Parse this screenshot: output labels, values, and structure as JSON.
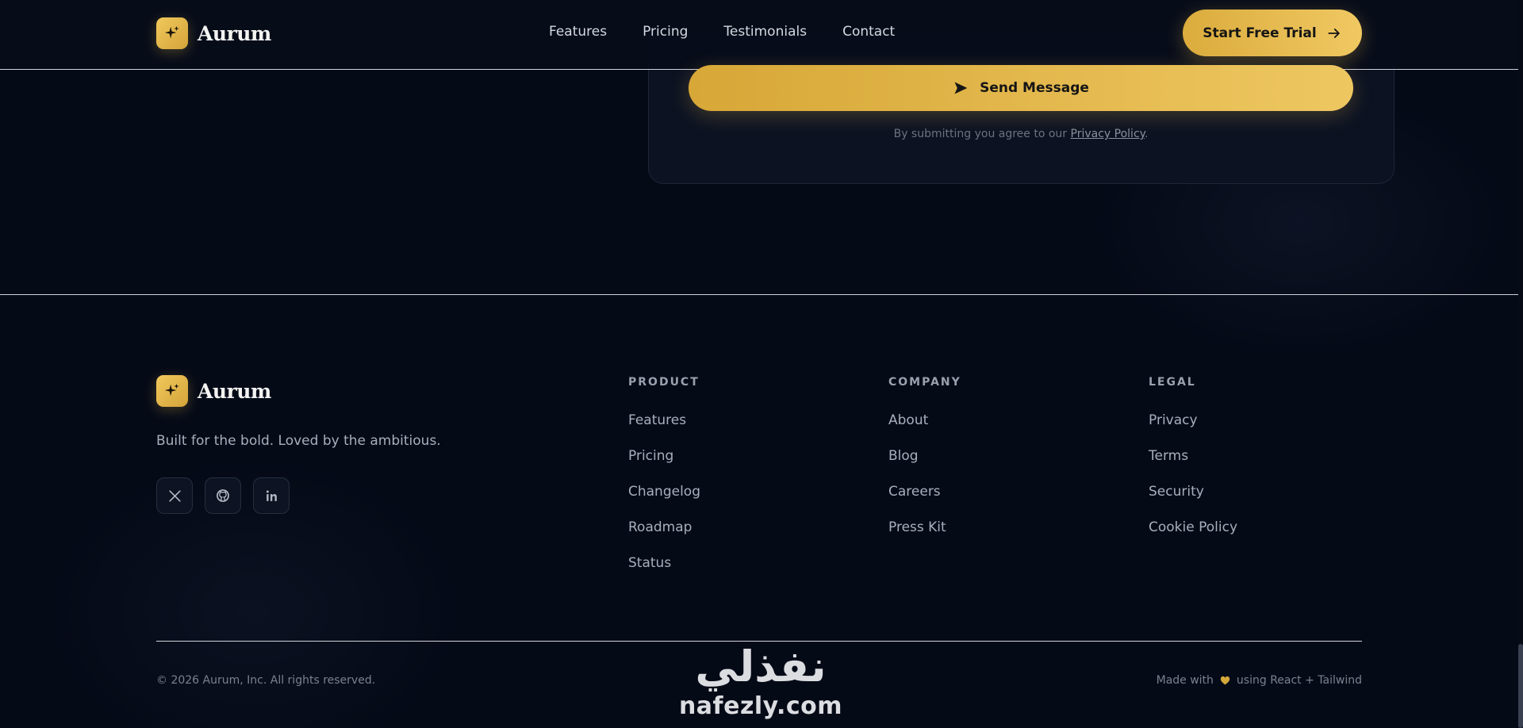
{
  "header": {
    "brand": "Aurum",
    "nav": [
      "Features",
      "Pricing",
      "Testimonials",
      "Contact"
    ],
    "cta_label": "Start Free Trial"
  },
  "contact_form": {
    "send_label": "Send Message",
    "terms_prefix": "By submitting you agree to our ",
    "privacy_link": "Privacy Policy",
    "terms_suffix": "."
  },
  "footer": {
    "brand": "Aurum",
    "tagline": "Built for the bold. Loved by the ambitious.",
    "socials": [
      "x-icon",
      "github-icon",
      "linkedin-icon"
    ],
    "columns": [
      {
        "title": "PRODUCT",
        "links": [
          "Features",
          "Pricing",
          "Changelog",
          "Roadmap",
          "Status"
        ]
      },
      {
        "title": "COMPANY",
        "links": [
          "About",
          "Blog",
          "Careers",
          "Press Kit"
        ]
      },
      {
        "title": "LEGAL",
        "links": [
          "Privacy",
          "Terms",
          "Security",
          "Cookie Policy"
        ]
      }
    ],
    "copyright": "© 2026 Aurum, Inc. All rights reserved.",
    "made_with_prefix": "Made with",
    "made_with_suffix": "using React + Tailwind"
  },
  "watermark": {
    "arabic": "نفذلي",
    "latin": "nafezly.com"
  },
  "colors": {
    "background": "#050a17",
    "accent_gold": "#e8b94b",
    "text_muted": "#a8afbb"
  }
}
